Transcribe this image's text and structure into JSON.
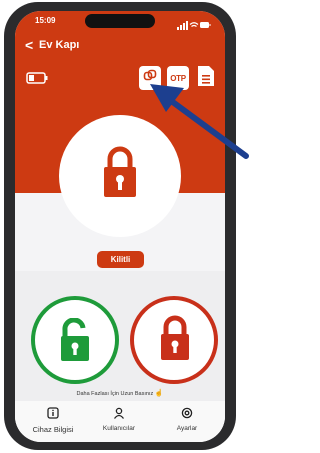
{
  "status_bar": {
    "time": "15:09"
  },
  "nav": {
    "back_label": "<",
    "title": "Ev Kapı"
  },
  "toolbar": {
    "otp_label": "OTP"
  },
  "lock_status": {
    "label": "Kilitli"
  },
  "hint": {
    "text": "Daha Fazlası İçin Uzun Basınız"
  },
  "tabs": [
    {
      "label": "Cihaz Bilgisi",
      "icon": "info-icon"
    },
    {
      "label": "Kullanıcılar",
      "icon": "user-icon"
    },
    {
      "label": "Ayarlar",
      "icon": "settings-icon"
    }
  ],
  "colors": {
    "accent": "#cd3a12",
    "unlock": "#1e9b3a",
    "lock": "#c8301a",
    "annotation_arrow": "#1d3f8f"
  }
}
